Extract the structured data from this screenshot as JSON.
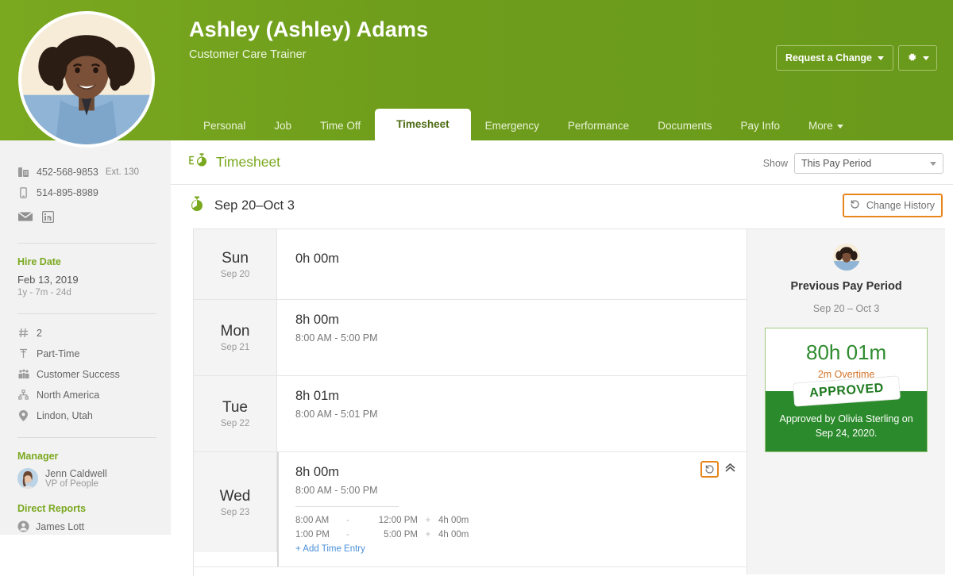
{
  "header": {
    "employee_name": "Ashley (Ashley) Adams",
    "job_title": "Customer Care Trainer",
    "request_change_label": "Request a Change",
    "gear_icon": "gear-icon",
    "brand_green": "#6e9d1c",
    "tabs": [
      {
        "label": "Personal",
        "active": false
      },
      {
        "label": "Job",
        "active": false
      },
      {
        "label": "Time Off",
        "active": false
      },
      {
        "label": "Timesheet",
        "active": true
      },
      {
        "label": "Emergency",
        "active": false
      },
      {
        "label": "Performance",
        "active": false
      },
      {
        "label": "Documents",
        "active": false
      },
      {
        "label": "Pay Info",
        "active": false
      },
      {
        "label": "More",
        "active": false,
        "has_caret": true
      }
    ]
  },
  "sidebar": {
    "work_phone": "452-568-9853",
    "work_ext": "Ext. 130",
    "mobile_phone": "514-895-8989",
    "social": [
      "email-icon",
      "linkedin-icon"
    ],
    "hire_date_label": "Hire Date",
    "hire_date": "Feb 13, 2019",
    "tenure": "1y - 7m - 24d",
    "attributes": [
      {
        "icon": "hash-icon",
        "value": "2"
      },
      {
        "icon": "clock-part-time-icon",
        "value": "Part-Time"
      },
      {
        "icon": "department-icon",
        "value": "Customer Success"
      },
      {
        "icon": "division-icon",
        "value": "North America"
      },
      {
        "icon": "location-pin-icon",
        "value": "Lindon, Utah"
      }
    ],
    "manager_label": "Manager",
    "manager_name": "Jenn Caldwell",
    "manager_role": "VP of People",
    "direct_reports_label": "Direct Reports",
    "direct_reports": [
      "James Lott"
    ]
  },
  "main": {
    "page_title": "Timesheet",
    "show_label": "Show",
    "show_value": "This Pay Period",
    "show_options": [
      "This Pay Period"
    ],
    "period_label": "Sep 20–Oct 3",
    "change_history_label": "Change History",
    "rows": [
      {
        "day": "Sun",
        "date": "Sep 20",
        "duration": "0h 00m",
        "span": "",
        "expanded": false
      },
      {
        "day": "Mon",
        "date": "Sep 21",
        "duration": "8h 00m",
        "span": "8:00 AM - 5:00 PM",
        "expanded": false
      },
      {
        "day": "Tue",
        "date": "Sep 22",
        "duration": "8h 01m",
        "span": "8:00 AM - 5:01 PM",
        "expanded": false
      },
      {
        "day": "Wed",
        "date": "Sep 23",
        "duration": "8h 00m",
        "span": "8:00 AM - 5:00 PM",
        "expanded": true,
        "entries": [
          {
            "start": "8:00 AM",
            "dash": "-",
            "end": "12:00 PM",
            "plus": "+",
            "total": "4h 00m"
          },
          {
            "start": "1:00 PM",
            "dash": "-",
            "end": "5:00 PM",
            "plus": "+",
            "total": "4h 00m"
          }
        ],
        "add_entry_label": "+ Add Time Entry",
        "history_icon": "history-icon",
        "collapse_icon": "chevron-up-icon"
      }
    ]
  },
  "summary": {
    "heading": "Previous Pay Period",
    "range": "Sep 20 – Oct 3",
    "hours": "80h 01m",
    "overtime": "2m Overtime",
    "stamp": "APPROVED",
    "approved_note": "Approved by Olivia Sterling on Sep 24, 2020.",
    "hours_color": "#2e8b2e",
    "overtime_color": "#d4742a",
    "banner_color": "#2b8a2b"
  }
}
